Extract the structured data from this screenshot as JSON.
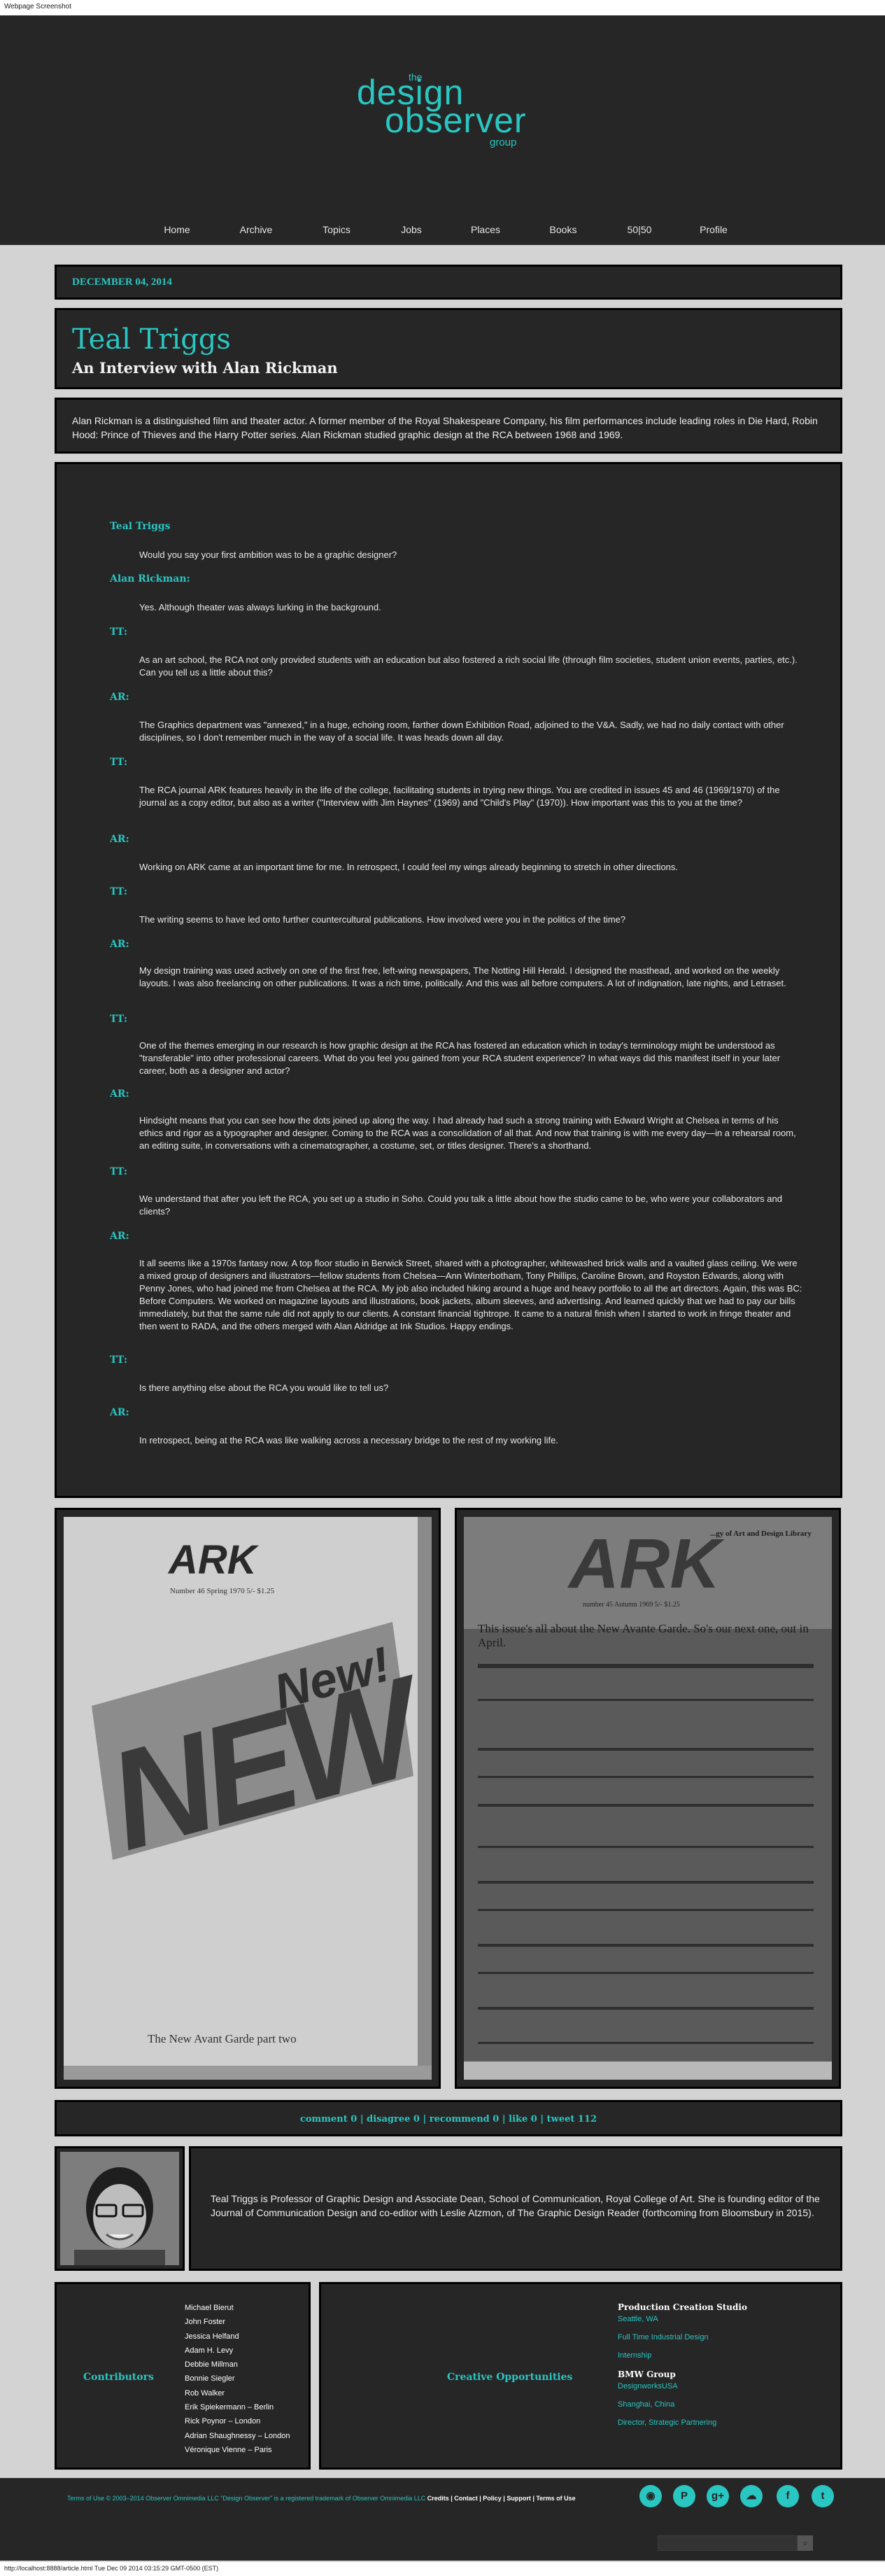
{
  "page_title": "Webpage Screenshot",
  "logo": {
    "the": "the",
    "design": "design",
    "observer": "observer",
    "group": "group"
  },
  "nav": [
    "Home",
    "Archive",
    "Topics",
    "Jobs",
    "Places",
    "Books",
    "50|50",
    "Profile"
  ],
  "date": "DECEMBER 04, 2014",
  "title": "Teal Triggs",
  "subtitle": "An Interview with Alan Rickman",
  "intro": "Alan Rickman is a distinguished film and theater actor. A former member of the Royal Shakespeare Company, his film performances include leading roles in Die Hard, Robin Hood: Prince of Thieves and the Harry Potter series. Alan Rickman studied graphic design at the RCA between 1968 and 1969.",
  "interview": [
    {
      "speaker": "Teal Triggs",
      "text": "Would you say your first ambition was to be a graphic designer?"
    },
    {
      "speaker": "Alan Rickman:",
      "text": "Yes. Although theater was always lurking in the background."
    },
    {
      "speaker": "TT:",
      "text": "As an art school, the RCA not only provided students with an education but also fostered a rich social life (through film societies, student union events, parties, etc.). Can you tell us a little about this?"
    },
    {
      "speaker": "AR:",
      "text": "The Graphics department was \"annexed,\" in a huge, echoing room, farther down Exhibition Road, adjoined to the V&A. Sadly, we had no daily contact with other disciplines, so I don't remember much in the way of a social life. It was heads down all day."
    },
    {
      "speaker": "TT:",
      "text": "The RCA journal ARK features heavily in the life of the college, facilitating students in trying new things. You are credited in issues 45 and 46 (1969/1970) of the journal as a copy editor, but also as a writer (\"Interview with Jim Haynes\" (1969) and \"Child's Play\" (1970)). How important was this to you at the time?"
    },
    {
      "speaker": "AR:",
      "text": "Working on ARK came at an important time for me. In retrospect, I could feel my wings already beginning to stretch in other directions."
    },
    {
      "speaker": "TT:",
      "text": "The writing seems to have led onto further countercultural publications. How involved were you in the politics of the time?"
    },
    {
      "speaker": "AR:",
      "text": "My design training was used actively on one of the first free, left-wing newspapers, The Notting Hill Herald. I designed the masthead, and worked on the weekly layouts. I was also freelancing on other publications. It was a rich time, politically. And this was all before computers. A lot of indignation, late nights, and Letraset."
    },
    {
      "speaker": "TT:",
      "text": "One of the themes emerging in our research is how graphic design at the RCA has fostered an education which in today's terminology might be understood as \"transferable\" into other professional careers. What do you feel you gained from your RCA student experience? In what ways did this manifest itself in your later career, both as a designer and actor?"
    },
    {
      "speaker": "AR:",
      "text": "Hindsight means that you can see how the dots joined up along the way. I had already had such a strong training with Edward Wright at Chelsea in terms of his ethics and rigor as a typographer and designer. Coming to the RCA was a consolidation of all that. And now that training is with me every day—in a rehearsal room, an editing suite, in conversations with a cinematographer, a costume, set, or titles designer. There's a shorthand."
    },
    {
      "speaker": "TT:",
      "text": "We understand that after you left the RCA, you set up a studio in Soho. Could you talk a little about how the studio came to be, who were your collaborators and clients?"
    },
    {
      "speaker": "AR:",
      "text": "It all seems like a 1970s fantasy now. A top floor studio in Berwick Street, shared with a photographer, whitewashed brick walls and a vaulted glass ceiling. We were a mixed group of designers and illustrators—fellow students from Chelsea—Ann Winterbotham, Tony Phillips, Caroline Brown, and Royston Edwards, along with Penny Jones, who had joined me from Chelsea at the RCA. My job also included hiking around a huge and heavy portfolio to all the art directors. Again, this was BC: Before Computers. We worked on magazine layouts and illustrations, book jackets, album sleeves, and advertising. And learned quickly that we had to pay our bills immediately, but that the same rule did not apply to our clients. A constant financial tightrope. It came to a natural finish when I started to work in fringe theater and then went to RADA, and the others merged with Alan Aldridge at Ink Studios. Happy endings."
    },
    {
      "speaker": "TT:",
      "text": "Is there anything else about the RCA you would like to tell us?"
    },
    {
      "speaker": "AR:",
      "text": "In retrospect, being at the RCA was like walking across a necessary bridge to the rest of my working life."
    }
  ],
  "covers": {
    "left": {
      "masthead": "ARK",
      "issue": "Number 46 Spring 1970 5/- $1.25",
      "headline": "NEW",
      "headline2": "New!",
      "footer": "The New Avant Garde part two"
    },
    "right": {
      "masthead": "ARK",
      "tag": "...gy of Art and Design Library",
      "issue": "number 45 Autumn 1969 5/- $1.25",
      "banner": "This issue's all about the New Avante Garde. So's our next one, out in April."
    }
  },
  "actions": [
    "comment 0",
    "disagree 0",
    "recommend 0",
    "like 0",
    "tweet 112"
  ],
  "bio": "Teal Triggs is Professor of Graphic Design and Associate Dean, School of Communication, Royal College of Art. She is founding editor of the Journal of Communication Design and co-editor with Leslie Atzmon, of The Graphic Design Reader (forthcoming from Bloomsbury in 2015).",
  "contributors": {
    "label": "Contributors",
    "names": [
      "Michael Bierut",
      "John Foster",
      "Jessica Helfand",
      "Adam H. Levy",
      "Debbie Millman",
      "Bonnie Siegler",
      "Rob Walker",
      "Erik Spiekermann – Berlin",
      "Rick Poynor – London",
      "Adrian Shaughnessy – London",
      "Véronique Vienne – Paris"
    ]
  },
  "opportunities": {
    "label": "Creative Opportunities",
    "groups": [
      {
        "heading": "Production Creation Studio",
        "links": [
          "Seattle, WA",
          "Full Time Industrial Design",
          "Internship"
        ]
      },
      {
        "heading": "BMW Group",
        "links": [
          "DesignworksUSA",
          "Shanghai, China",
          "Director, Strategic Partnering"
        ]
      }
    ]
  },
  "footer": {
    "copyright": "Terms of Use © 2003–2014 Observer Omnimedia LLC \"Design Observer\" is a registered trademark of Observer Omnimedia LLC",
    "links": "Credits | Contact | Policy | Support | Terms of Use"
  },
  "social_icons": [
    "rss-icon",
    "pinterest-icon",
    "google-plus-icon",
    "soundcloud-icon",
    "facebook-icon",
    "twitter-icon"
  ],
  "status_url": "http://localhost:8888/article.html Tue Dec 09 2014 03:15:29 GMT-0500 (EST)",
  "colors": {
    "accent": "#29c6c2",
    "panel": "#262626",
    "background": "#d3d3d3"
  }
}
